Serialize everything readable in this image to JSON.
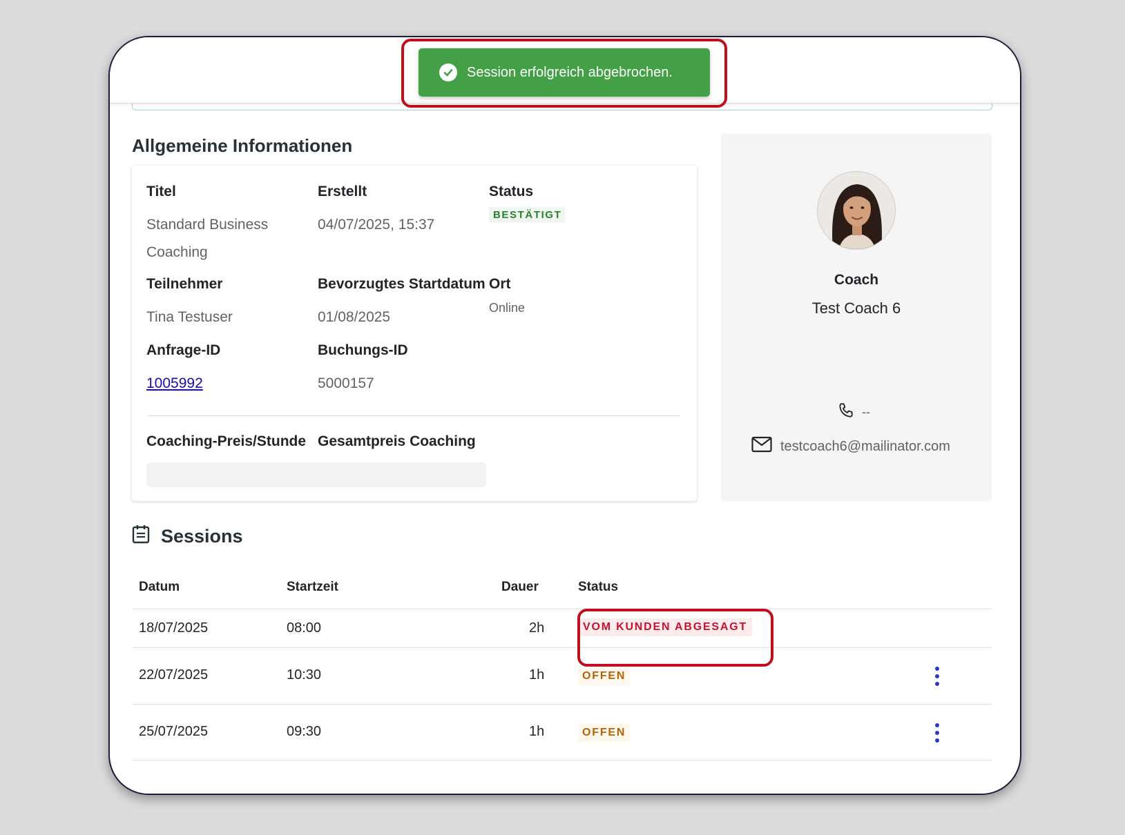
{
  "toast": {
    "message": "Session erfolgreich abgebrochen.",
    "color": "#43a047"
  },
  "info": {
    "section_title": "Allgemeine Informationen",
    "titel": {
      "label": "Titel",
      "value_line1": "Standard Business",
      "value_line2": "Coaching"
    },
    "erstellt": {
      "label": "Erstellt",
      "value": "04/07/2025, 15:37"
    },
    "status": {
      "label": "Status",
      "value": "BESTÄTIGT"
    },
    "teilnehmer": {
      "label": "Teilnehmer",
      "value": "Tina Testuser"
    },
    "startdatum": {
      "label": "Bevorzugtes Startdatum",
      "value": "01/08/2025"
    },
    "ort": {
      "label": "Ort",
      "value": "Online"
    },
    "anfrage_id": {
      "label": "Anfrage-ID",
      "value": "1005992"
    },
    "buchungs_id": {
      "label": "Buchungs-ID",
      "value": "5000157"
    },
    "preis_stunde": {
      "label": "Coaching-Preis/Stunde"
    },
    "gesamtpreis": {
      "label": "Gesamtpreis Coaching"
    }
  },
  "coach": {
    "role": "Coach",
    "name": "Test Coach 6",
    "phone": "--",
    "email": "testcoach6@mailinator.com"
  },
  "sessions": {
    "title": "Sessions",
    "columns": {
      "datum": "Datum",
      "startzeit": "Startzeit",
      "dauer": "Dauer",
      "status": "Status"
    },
    "rows": [
      {
        "datum": "18/07/2025",
        "startzeit": "08:00",
        "dauer": "2h",
        "status": "VOM KUNDEN ABGESAGT"
      },
      {
        "datum": "22/07/2025",
        "startzeit": "10:30",
        "dauer": "1h",
        "status": "OFFEN"
      },
      {
        "datum": "25/07/2025",
        "startzeit": "09:30",
        "dauer": "1h",
        "status": "OFFEN"
      }
    ]
  }
}
